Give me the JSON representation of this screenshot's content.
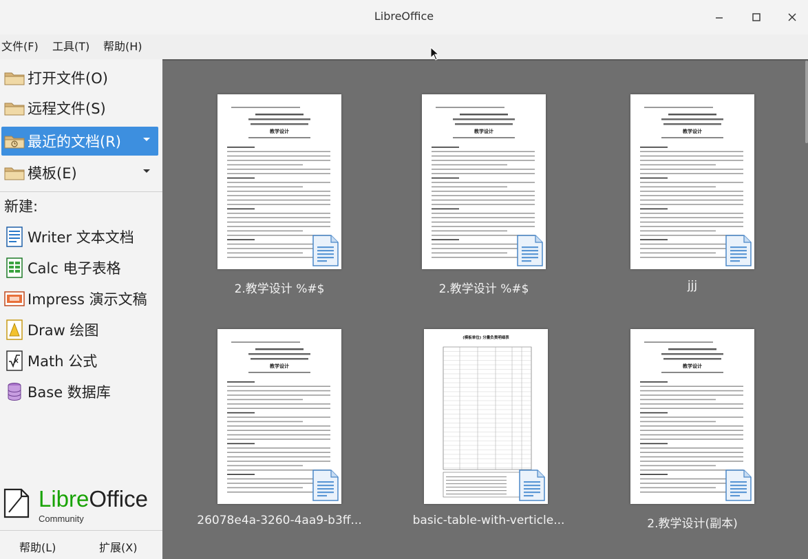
{
  "window": {
    "title": "LibreOffice"
  },
  "menu": {
    "file": "文件(F)",
    "tools": "工具(T)",
    "help": "帮助(H)"
  },
  "sidebar": {
    "open_file": "打开文件(O)",
    "remote_files": "远程文件(S)",
    "recent_docs": "最近的文档(R)",
    "templates": "模板(E)",
    "new_label": "新建:",
    "create": [
      {
        "label": "Writer 文本文档",
        "icon": "writer-icon"
      },
      {
        "label": "Calc 电子表格",
        "icon": "calc-icon"
      },
      {
        "label": "Impress 演示文稿",
        "icon": "impress-icon"
      },
      {
        "label": "Draw 绘图",
        "icon": "draw-icon"
      },
      {
        "label": "Math 公式",
        "icon": "math-icon"
      },
      {
        "label": "Base 数据库",
        "icon": "base-icon"
      }
    ],
    "logo": {
      "libre": "Libre",
      "office": "Office",
      "community": "Community"
    },
    "help_button": "帮助(L)",
    "extensions_button": "扩展(X)"
  },
  "recent": [
    {
      "caption": "2.教学设计 %#$",
      "heading": "教学设计"
    },
    {
      "caption": "2.教学设计 %#$",
      "heading": "教学设计"
    },
    {
      "caption": "jjj",
      "heading": "教学设计"
    },
    {
      "caption": "26078e4a-3260-4aa9-b3ff...",
      "heading": "教学设计"
    },
    {
      "caption": "basic-table-with-verticle...",
      "heading": "(模板单位) 分量负责明细表"
    },
    {
      "caption": "2.教学设计(副本)",
      "heading": "教学设计"
    }
  ],
  "colors": {
    "accent": "#3d8fdf",
    "main_bg": "#6f6f6f",
    "libre_green": "#18a303"
  }
}
